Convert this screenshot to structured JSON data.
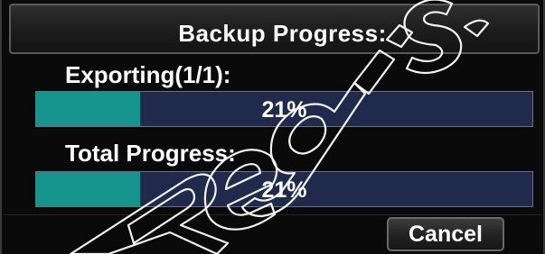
{
  "dialog": {
    "title": "Backup Progress:"
  },
  "export_progress": {
    "label": "Exporting(1/1):",
    "percent_text": "21%",
    "fraction": 0.21
  },
  "total_progress": {
    "label": "Total Progress:",
    "percent_text": "21%",
    "fraction": 0.21
  },
  "buttons": {
    "cancel_label": "Cancel"
  },
  "colors": {
    "background": "#0a0a0a",
    "bar_track": "#202a4c",
    "bar_fill": "#16958f",
    "text": "#ffffff"
  },
  "watermark": {
    "text": "Regis"
  }
}
